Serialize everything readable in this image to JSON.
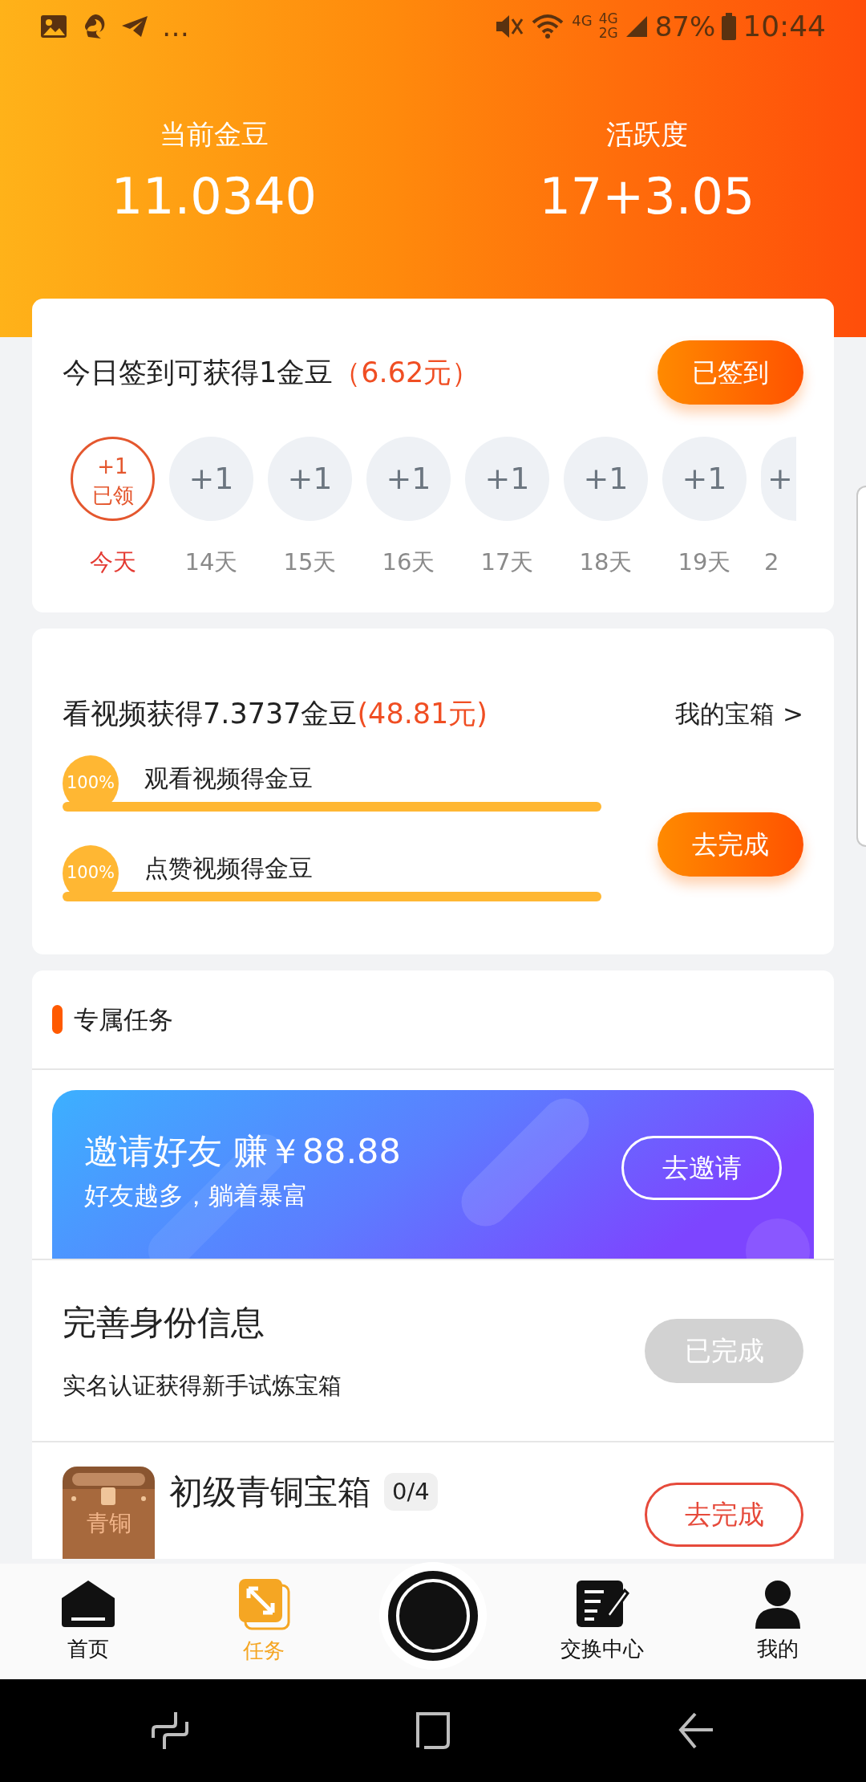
{
  "status_bar": {
    "more": "…",
    "network_1": "4G",
    "network_2_top": "4G",
    "network_2_bottom": "2G",
    "battery": "87%",
    "time": "10:44"
  },
  "stats": [
    {
      "label": "当前金豆",
      "value": "11.0340"
    },
    {
      "label": "活跃度",
      "value": "17+3.05"
    }
  ],
  "checkin": {
    "title": "今日签到可获得1金豆",
    "amount": "（6.62元）",
    "button": "已签到",
    "days": [
      {
        "reward": "+1",
        "status": "已领",
        "label": "今天",
        "claimed": true
      },
      {
        "reward": "+1",
        "label": "14天",
        "claimed": false
      },
      {
        "reward": "+1",
        "label": "15天",
        "claimed": false
      },
      {
        "reward": "+1",
        "label": "16天",
        "claimed": false
      },
      {
        "reward": "+1",
        "label": "17天",
        "claimed": false
      },
      {
        "reward": "+1",
        "label": "18天",
        "claimed": false
      },
      {
        "reward": "+1",
        "label": "19天",
        "claimed": false
      },
      {
        "reward": "+",
        "label": "2",
        "claimed": false
      }
    ]
  },
  "video": {
    "title": "看视频获得7.3737金豆",
    "amount": "(48.81元)",
    "link": "我的宝箱 >",
    "button": "去完成",
    "tasks": [
      {
        "percent": "100%",
        "label": "观看视频得金豆",
        "level": 1
      },
      {
        "percent": "100%",
        "label": "点赞视频得金豆",
        "level": 1
      }
    ]
  },
  "exclusive": {
    "title": "专属任务",
    "tasks": [
      {
        "kind": "banner",
        "title": "邀请好友 赚￥88.88",
        "subtitle": "好友越多，躺着暴富",
        "button": "去邀请"
      },
      {
        "kind": "task",
        "title": "完善身份信息",
        "subtitle": "实名认证获得新手试炼宝箱",
        "button": "已完成",
        "disabled": true
      },
      {
        "kind": "chest",
        "title": "初级青铜宝箱",
        "count": "0/4",
        "icon_label": "青铜",
        "button": "去完成",
        "disabled": false
      }
    ]
  },
  "tab_bar": [
    {
      "kind": "home",
      "label": "首页",
      "selected": false
    },
    {
      "kind": "tasks",
      "label": "任务",
      "selected": true
    },
    {
      "kind": "camera"
    },
    {
      "kind": "exchange",
      "label": "交换中心",
      "selected": false
    },
    {
      "kind": "profile",
      "label": "我的",
      "selected": false
    }
  ]
}
